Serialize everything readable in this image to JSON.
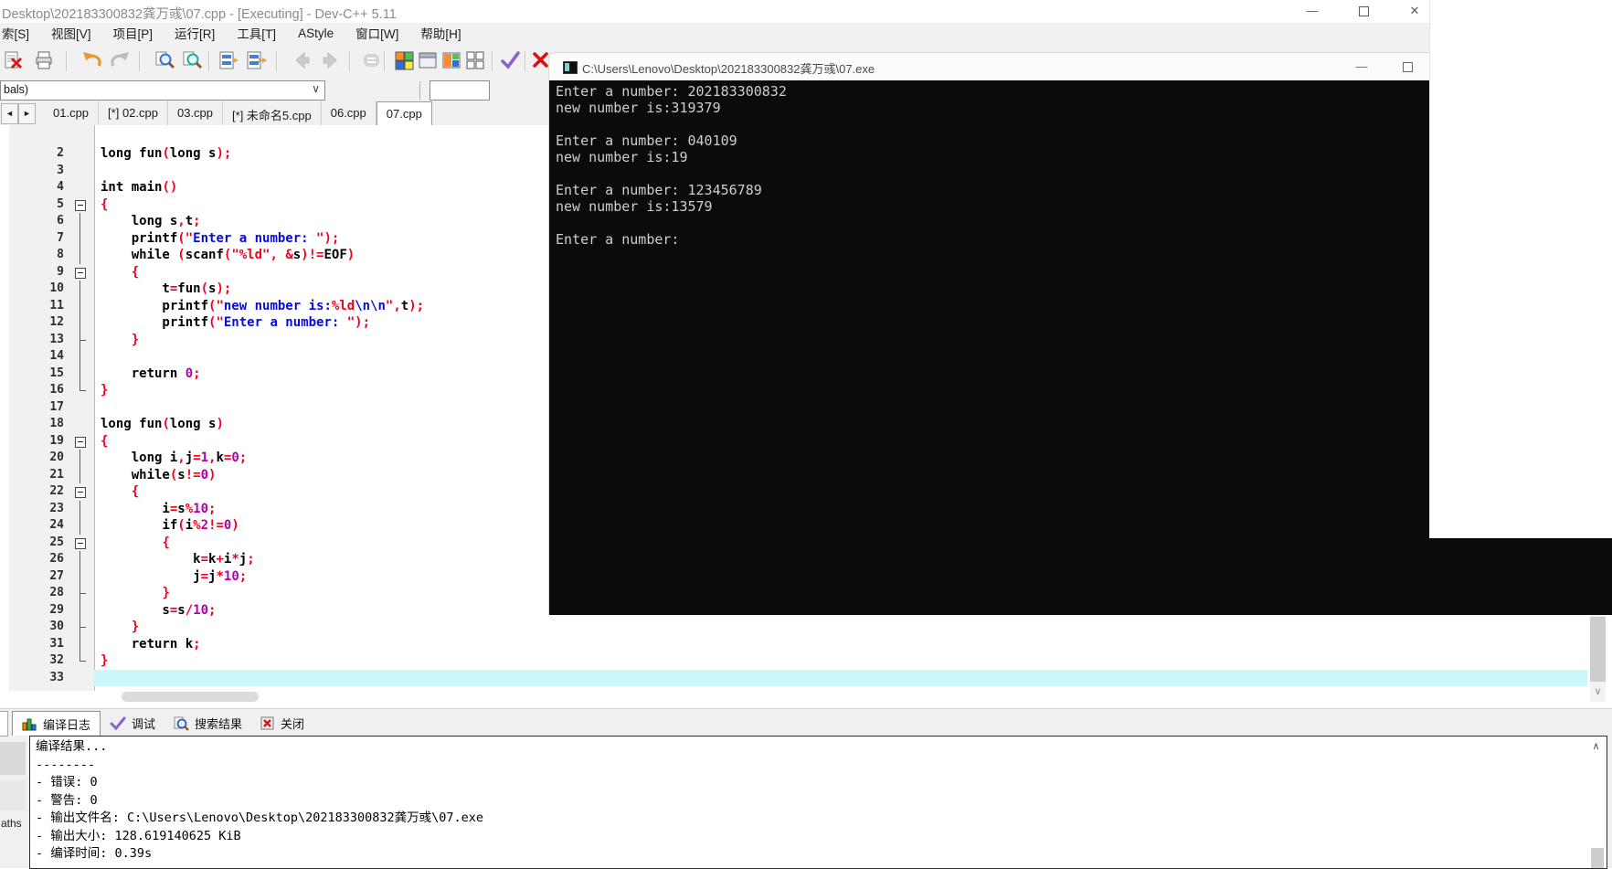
{
  "window": {
    "title": "Desktop\\202183300832龚万彧\\07.cpp - [Executing] - Dev-C++ 5.11",
    "minimize": "—",
    "close": "✕"
  },
  "menu": {
    "items": [
      "索[S]",
      "视图[V]",
      "项目[P]",
      "运行[R]",
      "工具[T]",
      "AStyle",
      "窗口[W]",
      "帮助[H]"
    ]
  },
  "toolbar": {
    "icons": [
      "close-file",
      "print",
      "undo",
      "redo",
      "find",
      "find-in-files",
      "replace",
      "replace-all",
      "nav-back",
      "nav-forward",
      "goto-line",
      "project-options",
      "window-plain",
      "window-color",
      "grid-outline",
      "syntax-check",
      "abort-compile"
    ]
  },
  "navigator": {
    "value": "bals)",
    "chevron": "∨"
  },
  "tab_scroll": {
    "left": "◄",
    "right": "►"
  },
  "tabs": {
    "items": [
      {
        "label": "01.cpp",
        "active": false
      },
      {
        "label": "[*] 02.cpp",
        "active": false
      },
      {
        "label": "03.cpp",
        "active": false
      },
      {
        "label": "[*] 未命名5.cpp",
        "active": false
      },
      {
        "label": "06.cpp",
        "active": false
      },
      {
        "label": "07.cpp",
        "active": true
      }
    ]
  },
  "editor": {
    "current_line": "33",
    "lines": [
      {
        "n": "2",
        "f": "",
        "s": [
          [
            "ck",
            "long fun"
          ],
          [
            "cr",
            "("
          ],
          [
            "ck",
            "long s"
          ],
          [
            "cr",
            ");"
          ]
        ]
      },
      {
        "n": "3",
        "f": "",
        "s": []
      },
      {
        "n": "4",
        "f": "",
        "s": [
          [
            "ck",
            "int main"
          ],
          [
            "cr",
            "()"
          ]
        ]
      },
      {
        "n": "5",
        "f": "box",
        "s": [
          [
            "cr",
            "{"
          ]
        ]
      },
      {
        "n": "6",
        "f": "bar",
        "s": [
          [
            "ck",
            "    long s"
          ],
          [
            "cr",
            ","
          ],
          [
            "ck",
            "t"
          ],
          [
            "cr",
            ";"
          ]
        ]
      },
      {
        "n": "7",
        "f": "bar",
        "s": [
          [
            "ck",
            "    printf"
          ],
          [
            "cr",
            "(\""
          ],
          [
            "cb",
            "Enter a number: "
          ],
          [
            "cr",
            "\");"
          ]
        ]
      },
      {
        "n": "8",
        "f": "bar",
        "s": [
          [
            "ck",
            "    while "
          ],
          [
            "cr",
            "("
          ],
          [
            "ck",
            "scanf"
          ],
          [
            "cr",
            "(\"%ld\", &"
          ],
          [
            "ck",
            "s"
          ],
          [
            "cr",
            ")!="
          ],
          [
            "ck",
            "EOF"
          ],
          [
            "cr",
            ")"
          ]
        ]
      },
      {
        "n": "9",
        "f": "box",
        "s": [
          [
            "ck",
            "    "
          ],
          [
            "cr",
            "{"
          ]
        ]
      },
      {
        "n": "10",
        "f": "bar",
        "s": [
          [
            "ck",
            "        t"
          ],
          [
            "cr",
            "="
          ],
          [
            "ck",
            "fun"
          ],
          [
            "cr",
            "("
          ],
          [
            "ck",
            "s"
          ],
          [
            "cr",
            ");"
          ]
        ]
      },
      {
        "n": "11",
        "f": "bar",
        "s": [
          [
            "ck",
            "        printf"
          ],
          [
            "cr",
            "(\""
          ],
          [
            "cb",
            "new number is:"
          ],
          [
            "cr",
            "%ld"
          ],
          [
            "cb",
            "\\n\\n"
          ],
          [
            "cr",
            "\","
          ],
          [
            "ck",
            "t"
          ],
          [
            "cr",
            ");"
          ]
        ]
      },
      {
        "n": "12",
        "f": "bar",
        "s": [
          [
            "ck",
            "        printf"
          ],
          [
            "cr",
            "(\""
          ],
          [
            "cb",
            "Enter a number: "
          ],
          [
            "cr",
            "\");"
          ]
        ]
      },
      {
        "n": "13",
        "f": "tick",
        "s": [
          [
            "ck",
            "    "
          ],
          [
            "cr",
            "}"
          ]
        ]
      },
      {
        "n": "14",
        "f": "bar",
        "s": []
      },
      {
        "n": "15",
        "f": "bar",
        "s": [
          [
            "ck",
            "    return "
          ],
          [
            "cp",
            "0"
          ],
          [
            "cr",
            ";"
          ]
        ]
      },
      {
        "n": "16",
        "f": "end",
        "s": [
          [
            "cr",
            "}"
          ]
        ]
      },
      {
        "n": "17",
        "f": "",
        "s": []
      },
      {
        "n": "18",
        "f": "",
        "s": [
          [
            "ck",
            "long fun"
          ],
          [
            "cr",
            "("
          ],
          [
            "ck",
            "long s"
          ],
          [
            "cr",
            ")"
          ]
        ]
      },
      {
        "n": "19",
        "f": "box",
        "s": [
          [
            "cr",
            "{"
          ]
        ]
      },
      {
        "n": "20",
        "f": "bar",
        "s": [
          [
            "ck",
            "    long i"
          ],
          [
            "cr",
            ","
          ],
          [
            "ck",
            "j"
          ],
          [
            "cr",
            "="
          ],
          [
            "cp",
            "1"
          ],
          [
            "cr",
            ","
          ],
          [
            "ck",
            "k"
          ],
          [
            "cr",
            "="
          ],
          [
            "cp",
            "0"
          ],
          [
            "cr",
            ";"
          ]
        ]
      },
      {
        "n": "21",
        "f": "bar",
        "s": [
          [
            "ck",
            "    while"
          ],
          [
            "cr",
            "("
          ],
          [
            "ck",
            "s"
          ],
          [
            "cr",
            "!="
          ],
          [
            "cp",
            "0"
          ],
          [
            "cr",
            ")"
          ]
        ]
      },
      {
        "n": "22",
        "f": "box",
        "s": [
          [
            "ck",
            "    "
          ],
          [
            "cr",
            "{"
          ]
        ]
      },
      {
        "n": "23",
        "f": "bar",
        "s": [
          [
            "ck",
            "        i"
          ],
          [
            "cr",
            "="
          ],
          [
            "ck",
            "s"
          ],
          [
            "cr",
            "%"
          ],
          [
            "cp",
            "10"
          ],
          [
            "cr",
            ";"
          ]
        ]
      },
      {
        "n": "24",
        "f": "bar",
        "s": [
          [
            "ck",
            "        if"
          ],
          [
            "cr",
            "("
          ],
          [
            "ck",
            "i"
          ],
          [
            "cr",
            "%"
          ],
          [
            "cp",
            "2"
          ],
          [
            "cr",
            "!="
          ],
          [
            "cp",
            "0"
          ],
          [
            "cr",
            ")"
          ]
        ]
      },
      {
        "n": "25",
        "f": "box",
        "s": [
          [
            "ck",
            "        "
          ],
          [
            "cr",
            "{"
          ]
        ]
      },
      {
        "n": "26",
        "f": "bar",
        "s": [
          [
            "ck",
            "            k"
          ],
          [
            "cr",
            "="
          ],
          [
            "ck",
            "k"
          ],
          [
            "cr",
            "+"
          ],
          [
            "ck",
            "i"
          ],
          [
            "cr",
            "*"
          ],
          [
            "ck",
            "j"
          ],
          [
            "cr",
            ";"
          ]
        ]
      },
      {
        "n": "27",
        "f": "bar",
        "s": [
          [
            "ck",
            "            j"
          ],
          [
            "cr",
            "="
          ],
          [
            "ck",
            "j"
          ],
          [
            "cr",
            "*"
          ],
          [
            "cp",
            "10"
          ],
          [
            "cr",
            ";"
          ]
        ]
      },
      {
        "n": "28",
        "f": "tick",
        "s": [
          [
            "ck",
            "        "
          ],
          [
            "cr",
            "}"
          ]
        ]
      },
      {
        "n": "29",
        "f": "bar",
        "s": [
          [
            "ck",
            "        s"
          ],
          [
            "cr",
            "="
          ],
          [
            "ck",
            "s"
          ],
          [
            "cr",
            "/"
          ],
          [
            "cp",
            "10"
          ],
          [
            "cr",
            ";"
          ]
        ]
      },
      {
        "n": "30",
        "f": "tick",
        "s": [
          [
            "ck",
            "    "
          ],
          [
            "cr",
            "}"
          ]
        ]
      },
      {
        "n": "31",
        "f": "bar",
        "s": [
          [
            "ck",
            "    return k"
          ],
          [
            "cr",
            ";"
          ]
        ]
      },
      {
        "n": "32",
        "f": "end",
        "s": [
          [
            "cr",
            "}"
          ]
        ]
      },
      {
        "n": "33",
        "f": "",
        "s": []
      }
    ]
  },
  "console": {
    "title": "C:\\Users\\Lenovo\\Desktop\\202183300832龚万彧\\07.exe",
    "minimize": "—",
    "lines": [
      "Enter a number: 202183300832",
      "new number is:319379",
      "",
      "Enter a number: 040109",
      "new number is:19",
      "",
      "Enter a number: 123456789",
      "new number is:13579",
      "",
      "Enter a number:"
    ]
  },
  "scrollbars": {
    "down_glyph": "∨",
    "up_glyph": "∧"
  },
  "bottom_tabs": {
    "items": [
      {
        "label": "编译日志",
        "icon": "bar-chart",
        "active": true
      },
      {
        "label": "调试",
        "icon": "check",
        "active": false
      },
      {
        "label": "搜索结果",
        "icon": "search",
        "active": false
      },
      {
        "label": "关闭",
        "icon": "close",
        "active": false
      }
    ]
  },
  "log": {
    "lines": [
      "编译结果...",
      "--------",
      "- 错误: 0",
      "- 警告: 0",
      "- 输出文件名: C:\\Users\\Lenovo\\Desktop\\202183300832龚万彧\\07.exe",
      "- 输出大小: 128.619140625 KiB",
      "- 编译时间: 0.39s"
    ],
    "side_text": "aths"
  },
  "colors": {
    "accent_cyan_line": "#cbf6fa",
    "code_red": "#f3001e",
    "code_blue": "#0a0ae0",
    "code_purple": "#b000b0",
    "console_bg": "#0b0b0b",
    "console_fg": "#cfcfcf",
    "chrome_bg": "#f1f1f1"
  }
}
